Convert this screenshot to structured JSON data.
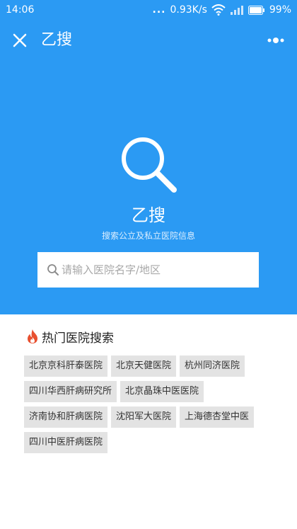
{
  "status_bar": {
    "time": "14:06",
    "dots": "...",
    "speed": "0.93K/s",
    "battery": "99%",
    "icons": [
      "wifi-icon",
      "signal-icon",
      "battery-icon"
    ]
  },
  "app_bar": {
    "title": "乙搜",
    "close_icon": "close-icon",
    "more_icon": "more-icon"
  },
  "hero": {
    "background": "#2b9af3",
    "icon": "search-icon",
    "title": "乙搜",
    "subtitle": "搜索公立及私立医院信息"
  },
  "search": {
    "placeholder": "请输入医院名字/地区",
    "value": ""
  },
  "hot": {
    "icon": "fire-icon",
    "title": "热门医院搜索",
    "tags": [
      "北京京科肝泰医院",
      "北京天健医院",
      "杭州同济医院",
      "四川华西肝病研究所",
      "北京晶珠中医医院",
      "济南协和肝病医院",
      "沈阳军大医院",
      "上海德杏堂中医",
      "四川中医肝病医院"
    ]
  }
}
